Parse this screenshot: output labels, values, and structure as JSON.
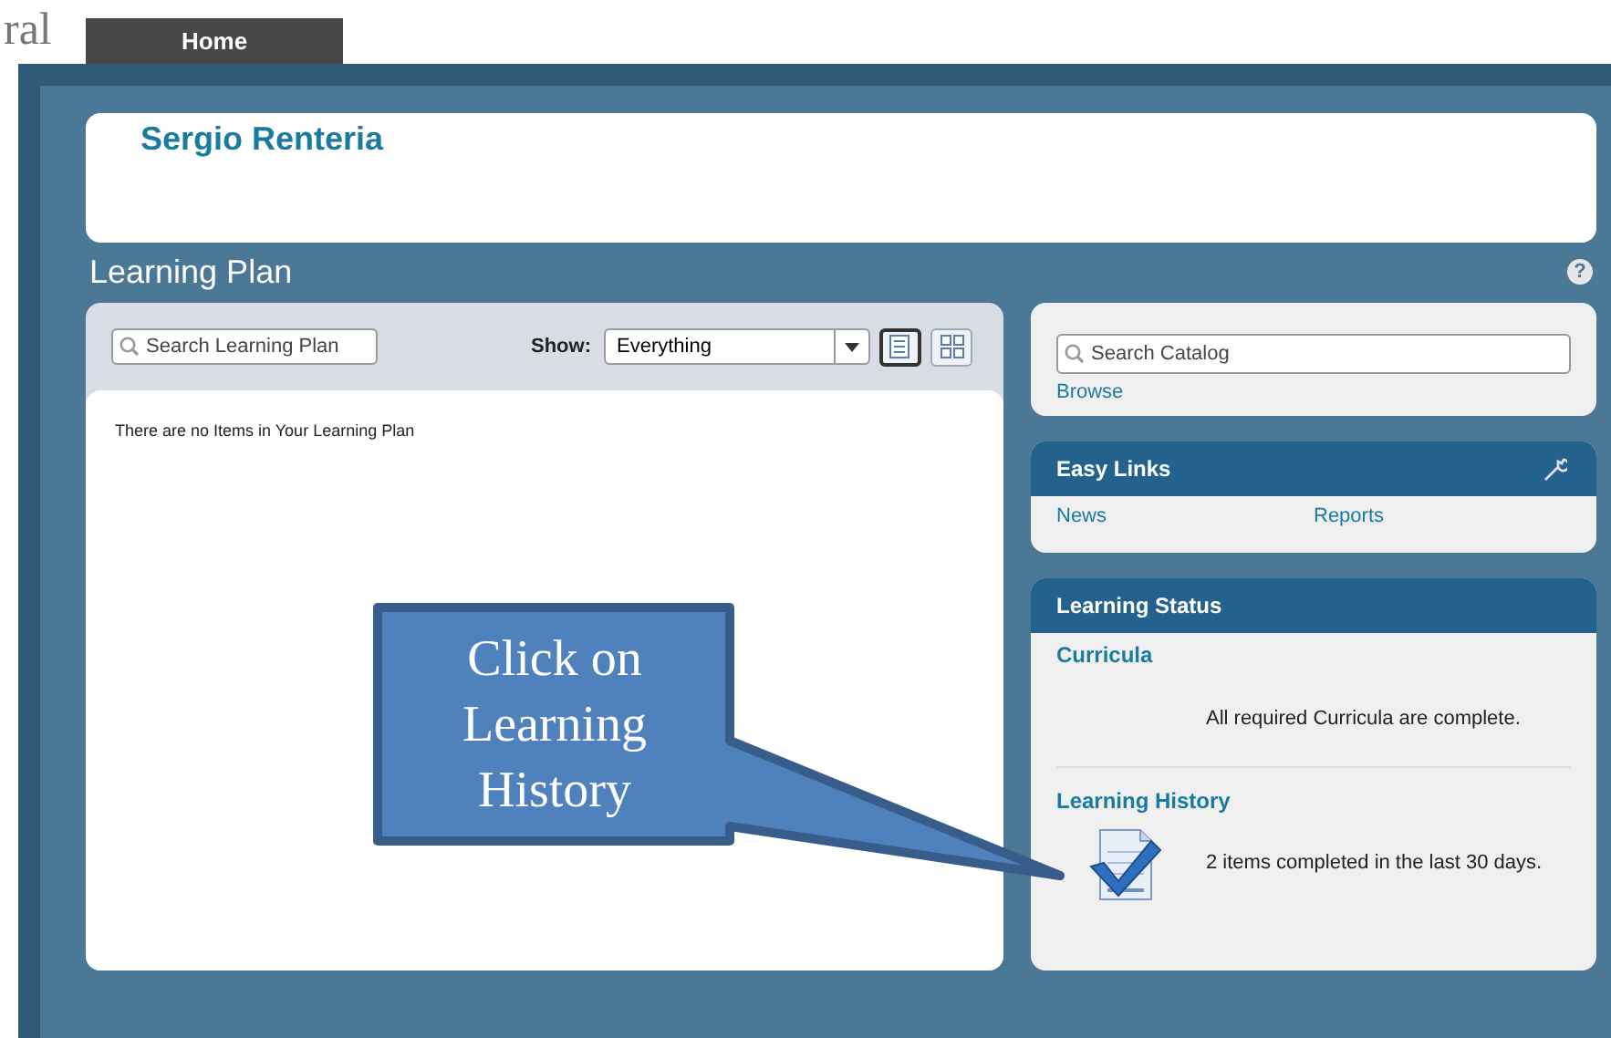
{
  "header": {
    "logo_fragment": "ral",
    "tabs": [
      {
        "label": "Home"
      }
    ]
  },
  "user": {
    "name": "Sergio  Renteria"
  },
  "learning_plan": {
    "title": "Learning Plan",
    "help": "?",
    "search": {
      "placeholder": "Search Learning Plan"
    },
    "show_label": "Show:",
    "show_value": "Everything",
    "views": [
      {
        "kind": "list",
        "selected": true
      },
      {
        "kind": "grid",
        "selected": false
      }
    ],
    "empty_message": "There are no Items in Your Learning Plan"
  },
  "catalog": {
    "search": {
      "placeholder": "Search Catalog"
    },
    "link": "Browse"
  },
  "easy_links": {
    "title": "Easy Links",
    "links": [
      "News",
      "Reports"
    ]
  },
  "learning_status": {
    "title": "Learning Status",
    "sections": [
      {
        "title": "Curricula",
        "message": "All required Curricula are complete.",
        "icon": false
      },
      {
        "title": "Learning History",
        "message": "2 items completed in the last 30 days.",
        "icon": true
      }
    ]
  },
  "callout": {
    "text": "Click on Learning History"
  }
}
